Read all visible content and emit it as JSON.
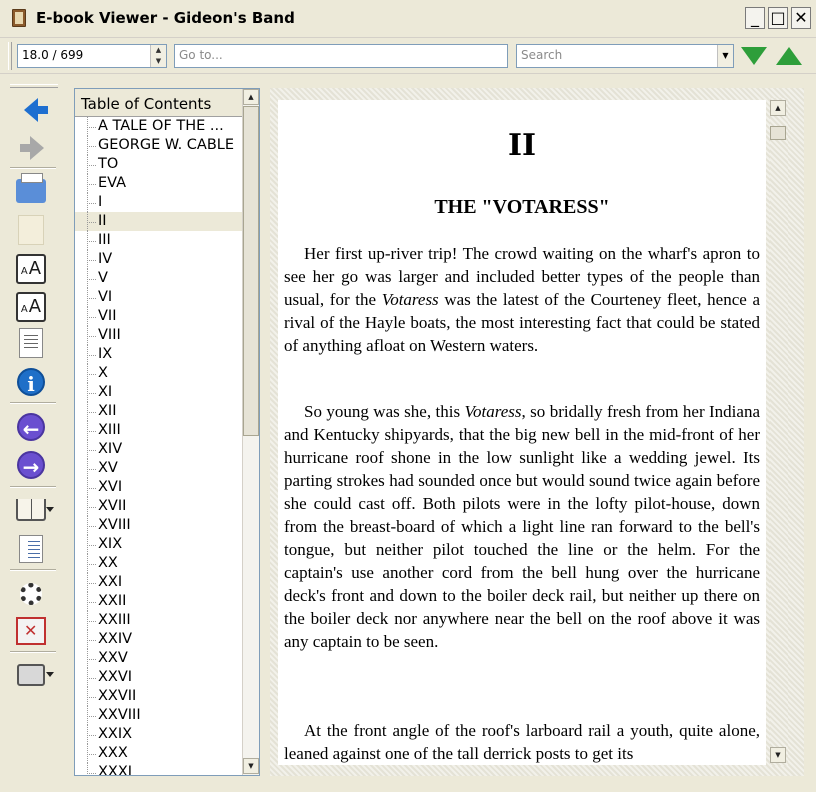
{
  "window": {
    "title": "E-book Viewer - Gideon's Band",
    "min_label": "_",
    "max_label": "□",
    "close_label": "✕"
  },
  "toolbar": {
    "position_value": "18.0 / 699",
    "goto_placeholder": "Go to...",
    "search_placeholder": "Search"
  },
  "toc": {
    "header": "Table of Contents",
    "selected": "II",
    "items": [
      "A TALE OF THE ...",
      "GEORGE W. CABLE",
      "TO",
      "EVA",
      "I",
      "II",
      "III",
      "IV",
      "V",
      "VI",
      "VII",
      "VIII",
      "IX",
      "X",
      "XI",
      "XII",
      "XIII",
      "XIV",
      "XV",
      "XVI",
      "XVII",
      "XVIII",
      "XIX",
      "XX",
      "XXI",
      "XXII",
      "XXIII",
      "XXIV",
      "XXV",
      "XXVI",
      "XXVII",
      "XXVIII",
      "XXIX",
      "XXX",
      "XXXI"
    ]
  },
  "content": {
    "chapter": "II",
    "chapter_title": "THE \"VOTARESS\"",
    "paragraphs": [
      [
        {
          "t": "Her first up-river trip! The crowd waiting on the wharf's apron to see her go was larger and included better types of the people than usual, for the "
        },
        {
          "t": "Votaress",
          "em": true
        },
        {
          "t": " was the latest of the Courteney fleet, hence a rival of the Hayle boats, the most interesting fact that could be stated of anything afloat on Western waters."
        }
      ],
      [
        {
          "t": "So young was she, this "
        },
        {
          "t": "Votaress",
          "em": true
        },
        {
          "t": ", so bridally fresh from her Indiana and Kentucky shipyards, that the big new bell in the mid-front of her hurricane roof shone in the low sunlight like a wedding jewel. Its parting strokes had sounded once but would sound twice again before she could cast off. Both pilots were in the lofty pilot-house, down from the breast-board of which a light line ran forward to the bell's tongue, but neither pilot touched the line or the helm. For the captain's use another cord from the bell hung over the hurricane deck's front and down to the boiler deck rail, but neither up there on the boiler deck nor anywhere near the bell on the roof above it was any captain to be seen."
        }
      ],
      [
        {
          "t": "At the front angle of the roof's larboard rail a youth, quite alone, leaned against one of the tall derrick posts to get its"
        }
      ]
    ]
  },
  "colors": {
    "nav_green": "#2e9e3a",
    "back_blue": "#1e6fd0",
    "circle_nav": "#6a4fd0"
  },
  "icons": {
    "back": "back-arrow-icon",
    "forward": "forward-arrow-icon",
    "print": "printer-icon",
    "copy": "copy-icon",
    "font_larger": "font-larger-icon",
    "font_smaller": "font-smaller-icon",
    "toc_toggle": "toc-toggle-icon",
    "info": "info-icon",
    "prev_page": "previous-icon",
    "next_page": "next-icon",
    "bookmarks": "bookmarks-icon",
    "reference": "reference-mode-icon",
    "preferences": "preferences-gear-icon",
    "fullscreen": "fullscreen-icon",
    "print_menu": "print-menu-icon"
  }
}
